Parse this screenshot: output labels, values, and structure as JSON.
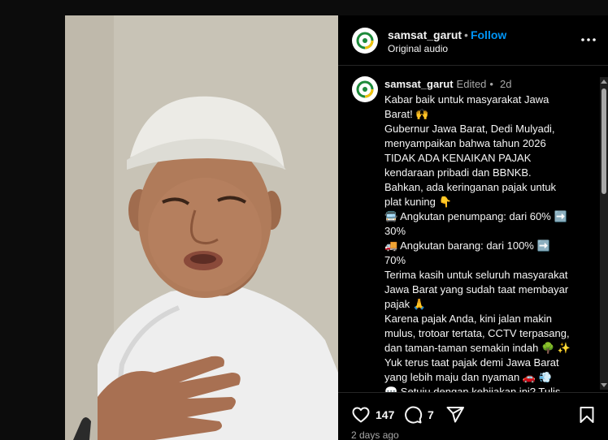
{
  "post": {
    "username": "samsat_garut",
    "follow_label": "Follow",
    "audio_label": "Original audio",
    "edited_label": "Edited",
    "separator": "•",
    "time_ago": "2d",
    "caption_lines": [
      "Kabar baik untuk masyarakat Jawa",
      "Barat! 🙌",
      "Gubernur Jawa Barat, Dedi Mulyadi,",
      "menyampaikan bahwa tahun 2026",
      "TIDAK ADA KENAIKAN PAJAK",
      "kendaraan pribadi dan BBNKB.",
      "Bahkan, ada keringanan pajak untuk",
      "plat kuning 👇",
      "🚍 Angkutan penumpang: dari 60% ➡️",
      "30%",
      "🚚 Angkutan barang: dari 100% ➡️",
      "70%",
      "Terima kasih untuk seluruh masyarakat",
      "Jawa Barat yang sudah taat membayar",
      "pajak 🙏",
      "Karena pajak Anda, kini jalan makin",
      "mulus, trotoar tertata, CCTV terpasang,",
      "dan taman-taman semakin indah 🌳 ✨",
      "Yuk terus taat pajak demi Jawa Barat",
      "yang lebih maju dan nyaman 🚗 💨",
      "💬 Setuju dengan kebijakan ini? Tulis"
    ],
    "likes": "147",
    "comments": "7",
    "date_label": "2 days ago"
  },
  "colors": {
    "background": "#000000",
    "text": "#f5f5f5",
    "muted": "#a8a8a8",
    "follow": "#0095f6",
    "divider": "#262626"
  },
  "icons": [
    "logo-avatar-icon",
    "more-options-icon",
    "heart-icon",
    "comment-icon",
    "share-icon",
    "bookmark-icon"
  ]
}
